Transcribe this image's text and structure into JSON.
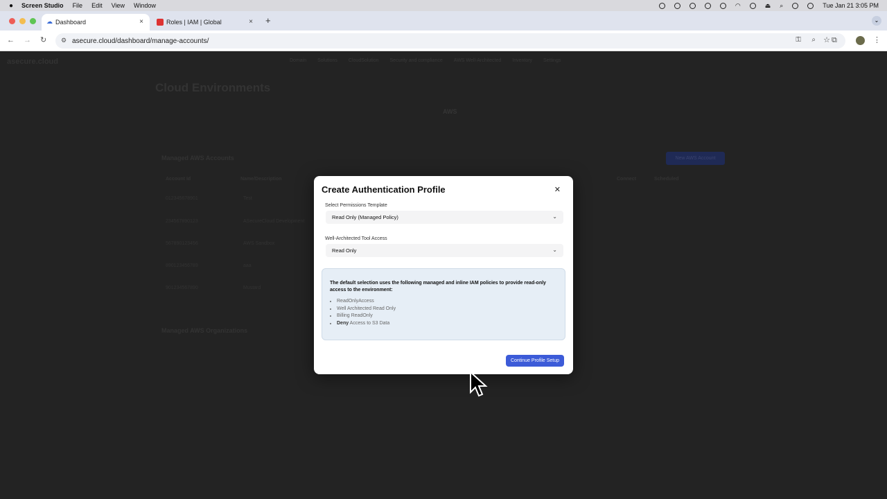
{
  "menubar": {
    "app": "Screen Studio",
    "items": [
      "File",
      "Edit",
      "View",
      "Window"
    ],
    "clock": "Tue Jan 21  3:05 PM"
  },
  "tabs": [
    {
      "label": "Dashboard"
    },
    {
      "label": "Roles | IAM | Global"
    }
  ],
  "browser": {
    "url": "asecure.cloud/dashboard/manage-accounts/"
  },
  "page": {
    "logo": "asecure.cloud",
    "nav": [
      "Domain",
      "Solutions",
      "CloudSolution",
      "Security and compliance",
      "AWS Well-Architected",
      "Inventory",
      "Settings"
    ],
    "title": "Cloud Environments",
    "provider_tab": "AWS",
    "section_accounts": "Managed AWS Accounts",
    "new_account_button": "New AWS Account",
    "columns": [
      "Account Id",
      "Name/Description",
      "Connect",
      "Scheduled"
    ],
    "rows": [
      {
        "id": "012345678901",
        "name": "Test"
      },
      {
        "id": "234567890123",
        "name": "ASecureCloud Development"
      },
      {
        "id": "567890123456",
        "name": "AWS Sandbox"
      },
      {
        "id": "890123456789",
        "name": "aaa"
      },
      {
        "id": "901234567890",
        "name": "Mustard"
      }
    ],
    "section_orgs": "Managed AWS Organizations"
  },
  "modal": {
    "title": "Create Authentication Profile",
    "template_label": "Select Permissions Template",
    "template_value": "Read Only (Managed Policy)",
    "tool_label": "Well-Architected Tool Access",
    "tool_value": "Read Only",
    "info_text": "The default selection uses the following managed and inline IAM policies to provide read-only access to the environment:",
    "policies": [
      "ReadOnlyAccess",
      "Well Architected Read Only",
      "Billing ReadOnly"
    ],
    "deny_bold": "Deny",
    "deny_rest": " Access to S3 Data",
    "continue_label": "Continue Profile Setup"
  }
}
